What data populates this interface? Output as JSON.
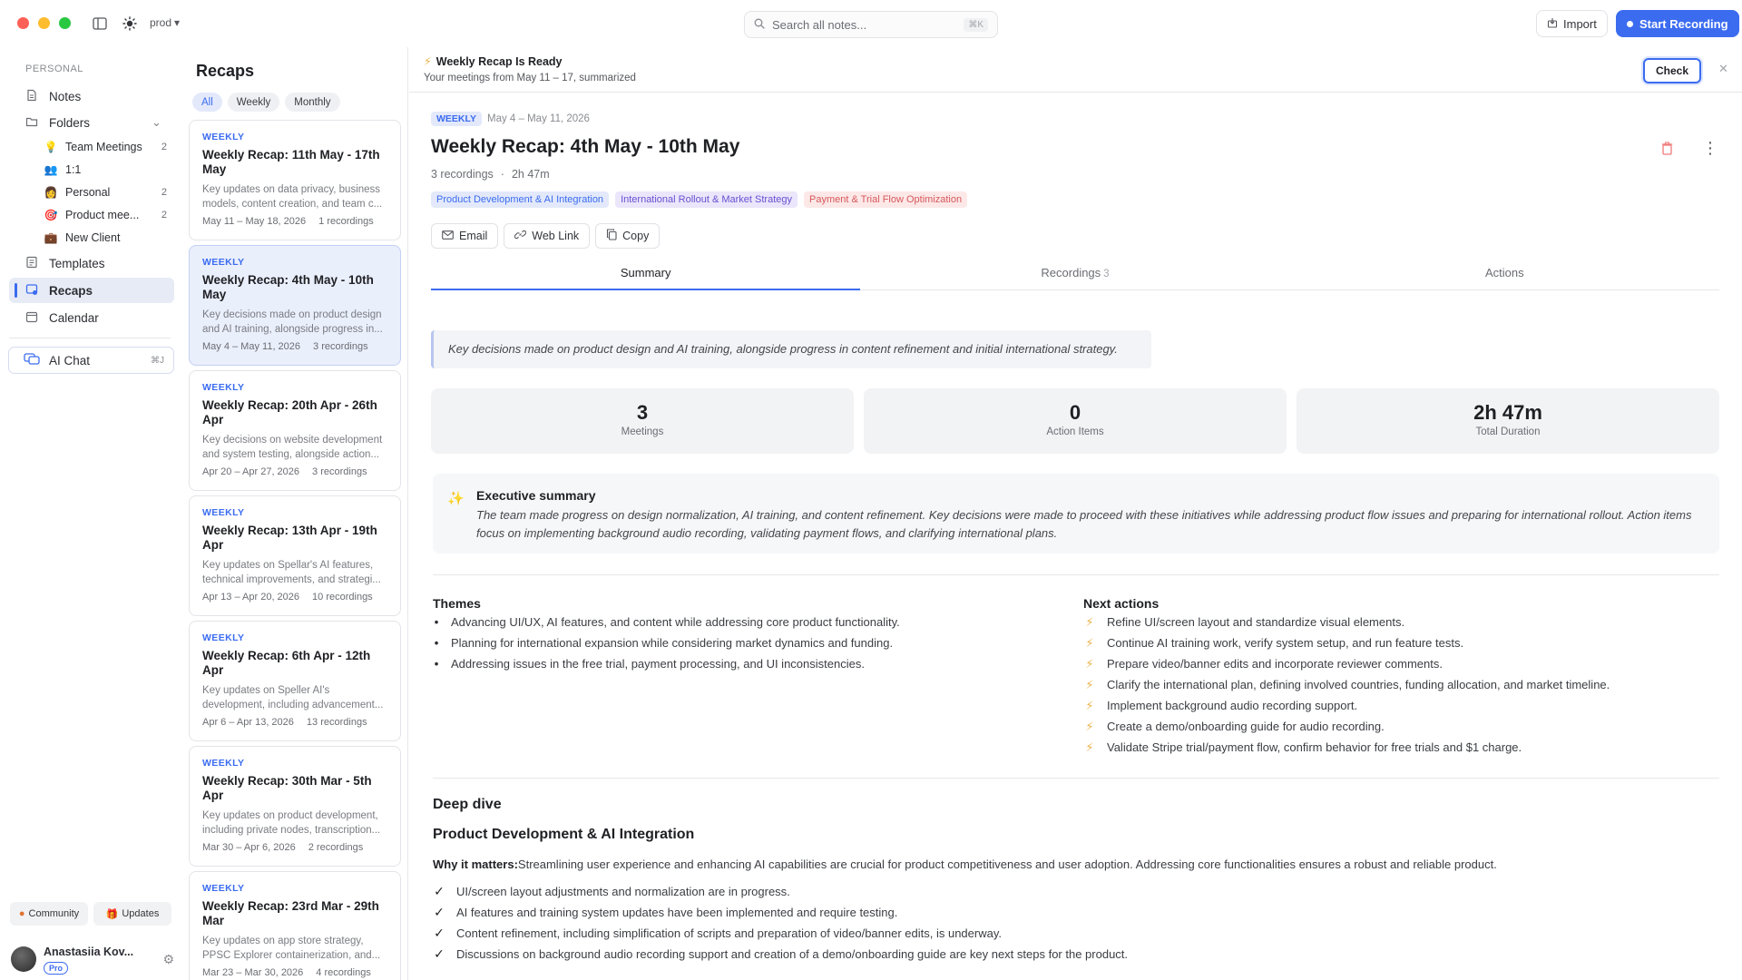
{
  "titlebar": {
    "env": "prod",
    "search_placeholder": "Search all notes...",
    "search_shortcut": "⌘K",
    "import_label": "Import",
    "record_label": "Start Recording"
  },
  "sidebar": {
    "section": "PERSONAL",
    "notes": "Notes",
    "folders": "Folders",
    "folder_items": [
      {
        "emoji": "💡",
        "label": "Team Meetings",
        "count": "2"
      },
      {
        "emoji": "👥",
        "label": "1:1",
        "count": ""
      },
      {
        "emoji": "👩",
        "label": "Personal",
        "count": "2"
      },
      {
        "emoji": "🎯",
        "label": "Product mee...",
        "count": "2"
      },
      {
        "emoji": "💼",
        "label": "New Client",
        "count": ""
      }
    ],
    "templates": "Templates",
    "recaps": "Recaps",
    "calendar": "Calendar",
    "ai_chat": "AI Chat",
    "ai_chat_shortcut": "⌘J",
    "community": "Community",
    "updates": "Updates",
    "user_name": "Anastasiia Kov...",
    "plan": "Pro"
  },
  "recaps": {
    "title": "Recaps",
    "filters": [
      "All",
      "Weekly",
      "Monthly"
    ],
    "cards": [
      {
        "tag": "WEEKLY",
        "title": "Weekly Recap: 11th May - 17th May",
        "desc": "Key updates on data privacy, business models, content creation, and team c...",
        "date": "May 11 – May 18, 2026",
        "count": "1 recordings"
      },
      {
        "tag": "WEEKLY",
        "title": "Weekly Recap: 4th May - 10th May",
        "desc": "Key decisions made on product design and AI training, alongside progress in...",
        "date": "May 4 – May 11, 2026",
        "count": "3 recordings"
      },
      {
        "tag": "WEEKLY",
        "title": "Weekly Recap: 20th Apr - 26th Apr",
        "desc": "Key decisions on website development and system testing, alongside action...",
        "date": "Apr 20 – Apr 27, 2026",
        "count": "3 recordings"
      },
      {
        "tag": "WEEKLY",
        "title": "Weekly Recap: 13th Apr - 19th Apr",
        "desc": "Key updates on Spellar's AI features, technical improvements, and strategi...",
        "date": "Apr 13 – Apr 20, 2026",
        "count": "10 recordings"
      },
      {
        "tag": "WEEKLY",
        "title": "Weekly Recap: 6th Apr - 12th Apr",
        "desc": "Key updates on Speller AI's development, including advancement...",
        "date": "Apr 6 – Apr 13, 2026",
        "count": "13 recordings"
      },
      {
        "tag": "WEEKLY",
        "title": "Weekly Recap: 30th Mar - 5th Apr",
        "desc": "Key updates on product development, including private nodes, transcription...",
        "date": "Mar 30 – Apr 6, 2026",
        "count": "2 recordings"
      },
      {
        "tag": "WEEKLY",
        "title": "Weekly Recap: 23rd Mar - 29th Mar",
        "desc": "Key updates on app store strategy, PPSC Explorer containerization, and...",
        "date": "Mar 23 – Mar 30, 2026",
        "count": "4 recordings"
      }
    ]
  },
  "banner": {
    "title": "Weekly Recap Is Ready",
    "subtitle": "Your meetings from May 11 – 17, summarized",
    "check": "Check"
  },
  "recap": {
    "tag": "WEEKLY",
    "date_range": "May 4 – May 11, 2026",
    "title": "Weekly Recap: 4th May - 10th May",
    "recordings": "3 recordings",
    "separator": "·",
    "duration": "2h 47m",
    "topics": [
      "Product Development & AI Integration",
      "International Rollout & Market Strategy",
      "Payment & Trial Flow Optimization"
    ],
    "share": [
      "Email",
      "Web Link",
      "Copy"
    ],
    "tabs": [
      {
        "label": "Summary",
        "count": ""
      },
      {
        "label": "Recordings",
        "count": "3"
      },
      {
        "label": "Actions",
        "count": ""
      }
    ],
    "quote": "Key decisions made on product design and AI training, alongside progress in content refinement and initial international strategy.",
    "stats": [
      {
        "value": "3",
        "label": "Meetings"
      },
      {
        "value": "0",
        "label": "Action Items"
      },
      {
        "value": "2h 47m",
        "label": "Total Duration"
      }
    ],
    "exec_title": "Executive summary",
    "exec_body": "The team made progress on design normalization, AI training, and content refinement. Key decisions were made to proceed with these initiatives while addressing product flow issues and preparing for international rollout. Action items focus on implementing background audio recording, validating payment flows, and clarifying international plans.",
    "themes_title": "Themes",
    "themes": [
      "Advancing UI/UX, AI features, and content while addressing core product functionality.",
      "Planning for international expansion while considering market dynamics and funding.",
      "Addressing issues in the free trial, payment processing, and UI inconsistencies."
    ],
    "next_title": "Next actions",
    "next_actions": [
      "Refine UI/screen layout and standardize visual elements.",
      "Continue AI training work, verify system setup, and run feature tests.",
      "Prepare video/banner edits and incorporate reviewer comments.",
      "Clarify the international plan, defining involved countries, funding allocation, and market timeline.",
      "Implement background audio recording support.",
      "Create a demo/onboarding guide for audio recording.",
      "Validate Stripe trial/payment flow, confirm behavior for free trials and $1 charge."
    ],
    "deep_dive": "Deep dive",
    "dd_section": "Product Development & AI Integration",
    "why_label": "Why it matters:",
    "why_text": "Streamlining user experience and enhancing AI capabilities are crucial for product competitiveness and user adoption. Addressing core functionalities ensures a robust and reliable product.",
    "dd_points": [
      "UI/screen layout adjustments and normalization are in progress.",
      "AI features and training system updates have been implemented and require testing.",
      "Content refinement, including simplification of scripts and preparation of video/banner edits, is underway.",
      "Discussions on background audio recording support and creation of a demo/onboarding guide are key next steps for the product."
    ]
  }
}
